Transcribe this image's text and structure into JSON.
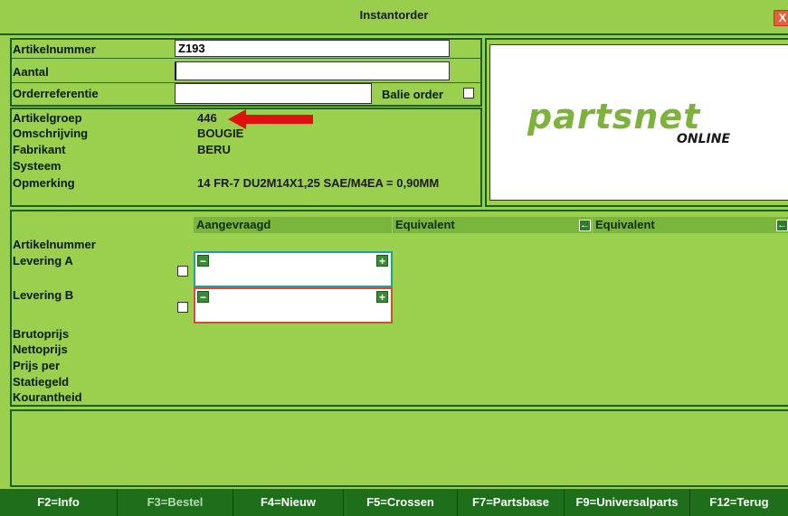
{
  "window": {
    "title": "Instantorder",
    "close_glyph": "X"
  },
  "order": {
    "artikelnummer_label": "Artikelnummer",
    "artikelnummer_value": "Z193",
    "aantal_label": "Aantal",
    "aantal_value": "",
    "orderreferentie_label": "Orderreferentie",
    "orderreferentie_value": "",
    "balie_label": "Balie order"
  },
  "details": {
    "artikelgroep_label": "Artikelgroep",
    "artikelgroep_value": "446",
    "omschrijving_label": "Omschrijving",
    "omschrijving_value": "BOUGIE",
    "fabrikant_label": "Fabrikant",
    "fabrikant_value": "BERU",
    "systeem_label": "Systeem",
    "systeem_value": "",
    "opmerking_label": "Opmerking",
    "opmerking_value": "14 FR-7 DU2M14X1,25 SAE/M4EA = 0,90MM"
  },
  "logo": {
    "main": "partsnet",
    "sub": "ONLINE"
  },
  "comparison": {
    "col_aangevraagd": "Aangevraagd",
    "col_equivalent1": "Equivalent",
    "col_equivalent2": "Equivalent",
    "arrow_glyph": "←",
    "minus_glyph": "−",
    "plus_glyph": "+",
    "rows": {
      "artikelnummer": "Artikelnummer",
      "levering_a": "Levering A",
      "levering_b": "Levering B",
      "brutoprijs": "Brutoprijs",
      "nettoprijs": "Nettoprijs",
      "prijs_per": "Prijs per",
      "statiegeld": "Statiegeld",
      "kourantheid": "Kourantheid"
    }
  },
  "colors": {
    "accent_green": "#9bd04e",
    "footer_green": "#1e6e1b",
    "levering_a_border": "#1ba39a",
    "levering_b_border": "#d84a3a",
    "annotation_arrow": "#e01010"
  },
  "footer": {
    "keys": [
      "F2=Info",
      "F3=Bestel",
      "F4=Nieuw",
      "F5=Crossen",
      "F7=Partsbase",
      "F9=Universalparts",
      "F12=Terug"
    ]
  }
}
